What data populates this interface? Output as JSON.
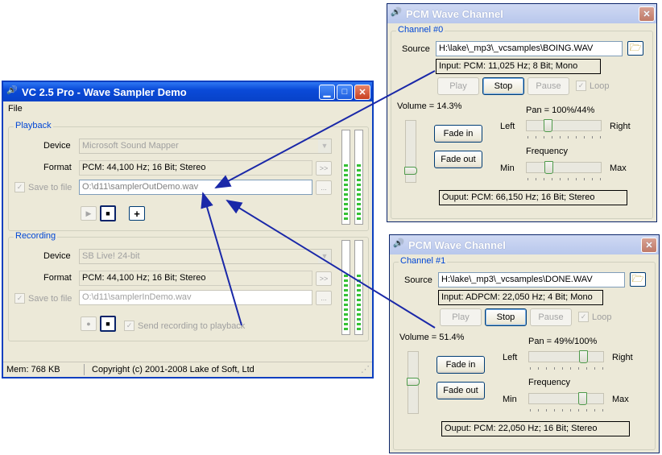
{
  "main": {
    "title": "VC 2.5 Pro - Wave Sampler Demo",
    "menu": "File",
    "playback": {
      "group": "Playback",
      "device_label": "Device",
      "device": "Microsoft Sound Mapper",
      "format_label": "Format",
      "format": "PCM: 44,100 Hz; 16 Bit; Stereo",
      "format_btn": ">>",
      "save_label": "Save to file",
      "save_path": "O:\\d11\\samplerOutDemo.wav",
      "browse": "...",
      "add": "+"
    },
    "recording": {
      "group": "Recording",
      "device_label": "Device",
      "device": "SB Live! 24-bit",
      "format_label": "Format",
      "format": "PCM: 44,100 Hz; 16 Bit; Stereo",
      "format_btn": ">>",
      "save_label": "Save to file",
      "save_path": "O:\\d11\\samplerInDemo.wav",
      "browse": "...",
      "send_label": "Send recording to playback"
    },
    "status": {
      "mem": "Mem: 768 KB",
      "copyright": "Copyright (c) 2001-2008 Lake of Soft, Ltd"
    }
  },
  "channels": [
    {
      "title": "PCM Wave Channel",
      "group": "Channel #0",
      "source_label": "Source",
      "source": "H:\\lake\\_mp3\\_vcsamples\\BOING.WAV",
      "input": "Input: PCM: 11,025 Hz; 8 Bit; Mono",
      "play": "Play",
      "stop": "Stop",
      "pause": "Pause",
      "loop": "Loop",
      "volume": "Volume = 14.3%",
      "volume_value": 0.143,
      "pan": "Pan = 100%/44%",
      "pan_value": 0.25,
      "left": "Left",
      "right": "Right",
      "fade_in": "Fade in",
      "fade_out": "Fade out",
      "frequency": "Frequency",
      "freq_value": 0.26,
      "min": "Min",
      "max": "Max",
      "output": "Ouput: PCM: 66,150 Hz; 16 Bit; Stereo"
    },
    {
      "title": "PCM Wave Channel",
      "group": "Channel #1",
      "source_label": "Source",
      "source": "H:\\lake\\_mp3\\_vcsamples\\DONE.WAV",
      "input": "Input: ADPCM: 22,050 Hz; 4 Bit; Mono",
      "play": "Play",
      "stop": "Stop",
      "pause": "Pause",
      "loop": "Loop",
      "volume": "Volume = 51.4%",
      "volume_value": 0.514,
      "pan": "Pan = 49%/100%",
      "pan_value": 0.75,
      "left": "Left",
      "right": "Right",
      "fade_in": "Fade in",
      "fade_out": "Fade out",
      "frequency": "Frequency",
      "freq_value": 0.74,
      "min": "Min",
      "max": "Max",
      "output": "Ouput: PCM: 22,050 Hz; 16 Bit; Stereo"
    }
  ],
  "colors": {
    "title_active": "#0a4ad8",
    "group_label": "#0046d5",
    "arrow": "#1a28a8",
    "meter": "#35c135"
  }
}
